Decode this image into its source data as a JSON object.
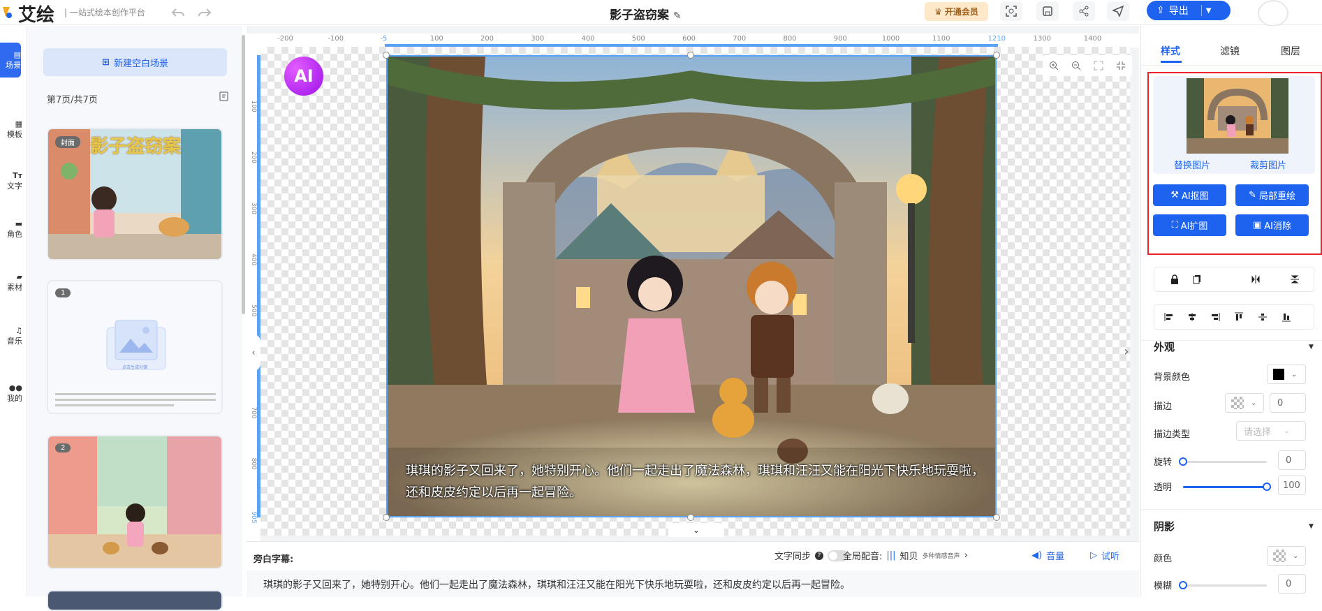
{
  "header": {
    "logo_text": "艾绘",
    "logo_sub": "| 一站式绘本创作平台",
    "doc_title": "影子盗窃案",
    "vip_label": "开通会员",
    "export_label": "导出"
  },
  "rail": {
    "items": [
      {
        "label": "场景",
        "icon": "scene-icon"
      },
      {
        "label": "模板",
        "icon": "template-icon"
      },
      {
        "label": "文字",
        "icon": "text-icon"
      },
      {
        "label": "角色",
        "icon": "character-icon"
      },
      {
        "label": "素材",
        "icon": "folder-icon"
      },
      {
        "label": "音乐",
        "icon": "music-icon"
      },
      {
        "label": "我的",
        "icon": "users-icon"
      }
    ]
  },
  "scenes": {
    "new_scene_label": "新建空白场景",
    "page_count": "第7页/共7页",
    "cards": [
      {
        "badge": "封面",
        "title": "影子盗窃案"
      },
      {
        "badge": "1",
        "placeholder": "点击生成分镜"
      },
      {
        "badge": "2"
      }
    ]
  },
  "canvas": {
    "ai_badge": "AI",
    "caption": "琪琪的影子又回来了，她特别开心。他们一起走出了魔法森林，琪琪和汪汪又能在阳光下快乐地玩耍啦，还和皮皮约定以后再一起冒险。",
    "ruler_h": [
      "-200",
      "-100",
      "-5",
      "100",
      "200",
      "300",
      "400",
      "500",
      "600",
      "700",
      "800",
      "900",
      "1000",
      "1100",
      "1210",
      "1300",
      "1400"
    ],
    "ruler_v": [
      "100",
      "200",
      "300",
      "400",
      "500",
      "600",
      "700",
      "800",
      "905"
    ]
  },
  "narration": {
    "label": "旁白字幕:",
    "sync_label": "文字同步",
    "global_voice_label": "全局配音:",
    "voice_name": "知贝",
    "voice_desc": "多种情感音声",
    "volume_label": "音量",
    "try_label": "试听",
    "text": "琪琪的影子又回来了，她特别开心。他们一起走出了魔法森林，琪琪和汪汪又能在阳光下快乐地玩耍啦，还和皮皮约定以后再一起冒险。"
  },
  "props": {
    "tabs": [
      "样式",
      "滤镜",
      "图层"
    ],
    "replace_label": "替换图片",
    "crop_label": "裁剪图片",
    "ai_buttons": [
      "AI抠图",
      "局部重绘",
      "AI扩图",
      "AI消除"
    ],
    "appearance_title": "外观",
    "bg_color_label": "背景颜色",
    "stroke_label": "描边",
    "stroke_value": "0",
    "stroke_type_label": "描边类型",
    "stroke_type_placeholder": "请选择",
    "rotate_label": "旋转",
    "rotate_value": "0",
    "opacity_label": "透明",
    "opacity_value": "100",
    "shadow_title": "阴影",
    "shadow_color_label": "颜色",
    "blur_label": "模糊",
    "blur_value": "0",
    "bg_color": "#000000",
    "accent": "#1e63f0"
  }
}
